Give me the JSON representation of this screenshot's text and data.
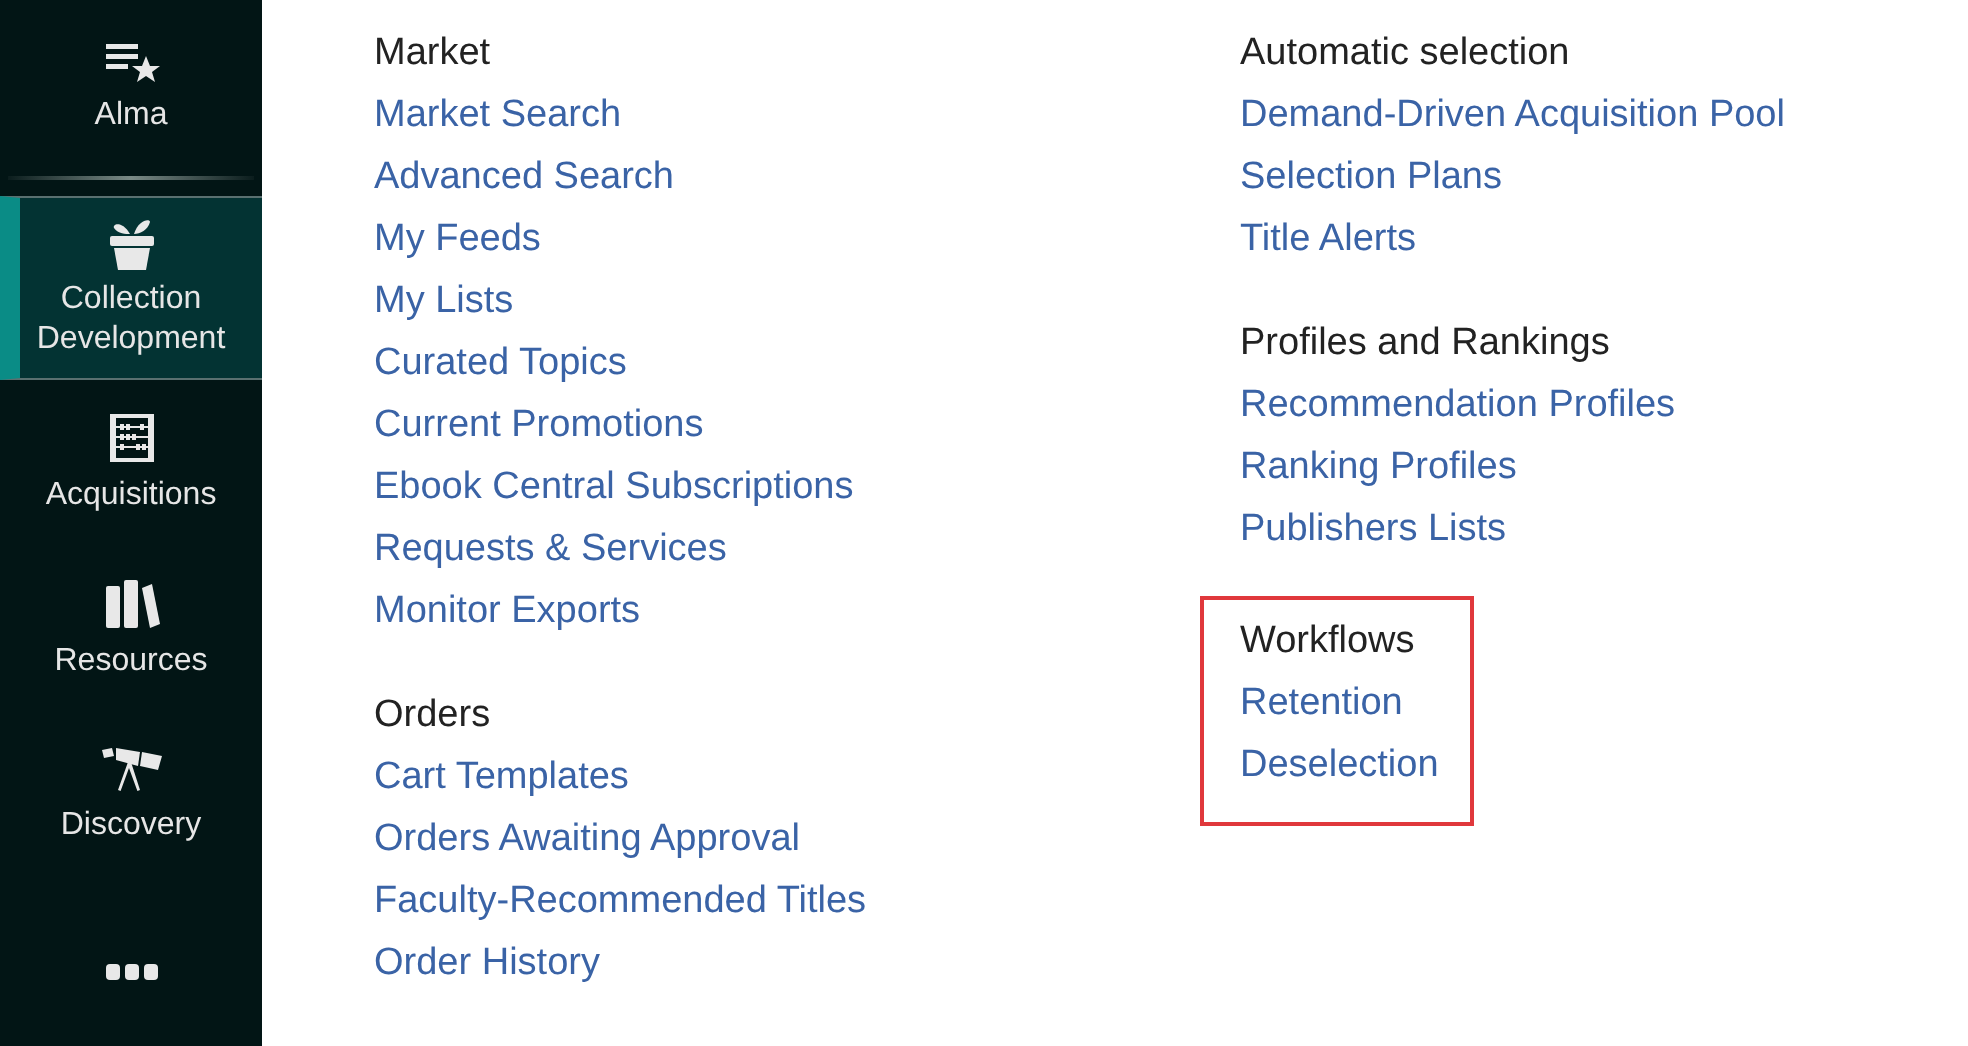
{
  "sidebar": {
    "items": [
      {
        "label": "Alma",
        "selected": false
      },
      {
        "label": "Collection Development",
        "selected": true
      },
      {
        "label": "Acquisitions",
        "selected": false
      },
      {
        "label": "Resources",
        "selected": false
      },
      {
        "label": "Discovery",
        "selected": false
      }
    ]
  },
  "columns": [
    [
      {
        "heading": "Market",
        "highlighted": false,
        "links": [
          "Market Search",
          "Advanced Search",
          "My Feeds",
          "My Lists",
          "Curated Topics",
          "Current Promotions",
          "Ebook Central Subscriptions",
          "Requests & Services",
          "Monitor Exports"
        ]
      },
      {
        "heading": "Orders",
        "highlighted": false,
        "links": [
          "Cart Templates",
          "Orders Awaiting Approval",
          "Faculty-Recommended Titles",
          "Order History"
        ]
      }
    ],
    [
      {
        "heading": "Automatic selection",
        "highlighted": false,
        "links": [
          "Demand-Driven Acquisition Pool",
          "Selection Plans",
          "Title Alerts"
        ]
      },
      {
        "heading": "Profiles and Rankings",
        "highlighted": false,
        "links": [
          "Recommendation Profiles",
          "Ranking Profiles",
          "Publishers Lists"
        ]
      },
      {
        "heading": "Workflows",
        "highlighted": true,
        "links": [
          "Retention",
          "Deselection"
        ]
      }
    ]
  ]
}
